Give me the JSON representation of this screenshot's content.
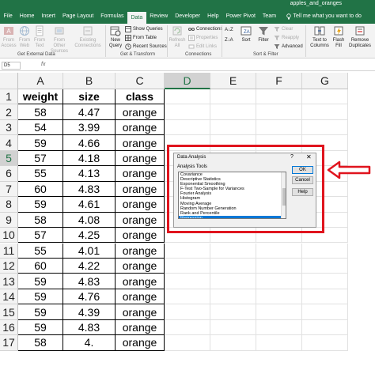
{
  "window": {
    "title": "apples_and_oranges"
  },
  "tabs": [
    "File",
    "Home",
    "Insert",
    "Page Layout",
    "Formulas",
    "Data",
    "Review",
    "Developer",
    "Help",
    "Power Pivot",
    "Team"
  ],
  "active_tab": "Data",
  "tell_me": "Tell me what you want to do",
  "ribbon": {
    "get_data": {
      "from_access": "From Access",
      "from_web": "From Web",
      "from_text": "From Text",
      "from_other": "From Other Sources",
      "existing": "Existing Connections",
      "group": "Get External Data"
    },
    "transform": {
      "new_query": "New Query",
      "show_queries": "Show Queries",
      "from_table": "From Table",
      "recent_sources": "Recent Sources",
      "group": "Get & Transform"
    },
    "connections": {
      "refresh_all": "Refresh All",
      "connections": "Connections",
      "properties": "Properties",
      "edit_links": "Edit Links",
      "group": "Connections"
    },
    "sort_filter": {
      "sort_az": "A↓Z",
      "sort_za": "Z↓A",
      "sort": "Sort",
      "filter": "Filter",
      "clear": "Clear",
      "reapply": "Reapply",
      "advanced": "Advanced",
      "group": "Sort & Filter"
    },
    "data_tools": {
      "text_to_columns": "Text to Columns",
      "flash_fill": "Flash Fill",
      "remove_duplicates": "Remove Duplicates"
    }
  },
  "formula_bar": {
    "name_box": "D5",
    "fx": "fx"
  },
  "sheet": {
    "columns": [
      "A",
      "B",
      "C",
      "D",
      "E",
      "F",
      "G"
    ],
    "selected_column": "D",
    "selected_row": "5",
    "row_numbers": [
      "1",
      "2",
      "3",
      "4",
      "5",
      "6",
      "7",
      "8",
      "9",
      "10",
      "11",
      "12",
      "13",
      "14",
      "15",
      "16",
      "17"
    ],
    "headers": [
      "weight",
      "size",
      "class"
    ],
    "rows": [
      [
        "58",
        "4.47",
        "orange"
      ],
      [
        "54",
        "3.99",
        "orange"
      ],
      [
        "59",
        "4.66",
        "orange"
      ],
      [
        "57",
        "4.18",
        "orange"
      ],
      [
        "55",
        "4.13",
        "orange"
      ],
      [
        "60",
        "4.83",
        "orange"
      ],
      [
        "59",
        "4.61",
        "orange"
      ],
      [
        "58",
        "4.08",
        "orange"
      ],
      [
        "57",
        "4.25",
        "orange"
      ],
      [
        "55",
        "4.01",
        "orange"
      ],
      [
        "60",
        "4.22",
        "orange"
      ],
      [
        "59",
        "4.83",
        "orange"
      ],
      [
        "59",
        "4.76",
        "orange"
      ],
      [
        "59",
        "4.39",
        "orange"
      ],
      [
        "59",
        "4.83",
        "orange"
      ],
      [
        "58",
        "4.",
        "orange"
      ]
    ]
  },
  "dialog": {
    "title": "Data Analysis",
    "help_glyph": "?",
    "close_glyph": "✕",
    "label": "Analysis Tools",
    "tools": [
      "Covariance",
      "Descriptive Statistics",
      "Exponential Smoothing",
      "F-Test Two-Sample for Variances",
      "Fourier Analysis",
      "Histogram",
      "Moving Average",
      "Random Number Generation",
      "Rank and Percentile",
      "Regression"
    ],
    "selected_tool": "Regression",
    "ok": "OK",
    "cancel": "Cancel",
    "help": "Help"
  },
  "colors": {
    "excel_green": "#217346",
    "highlight_red": "#e0141e",
    "selection_blue": "#0078d7"
  }
}
